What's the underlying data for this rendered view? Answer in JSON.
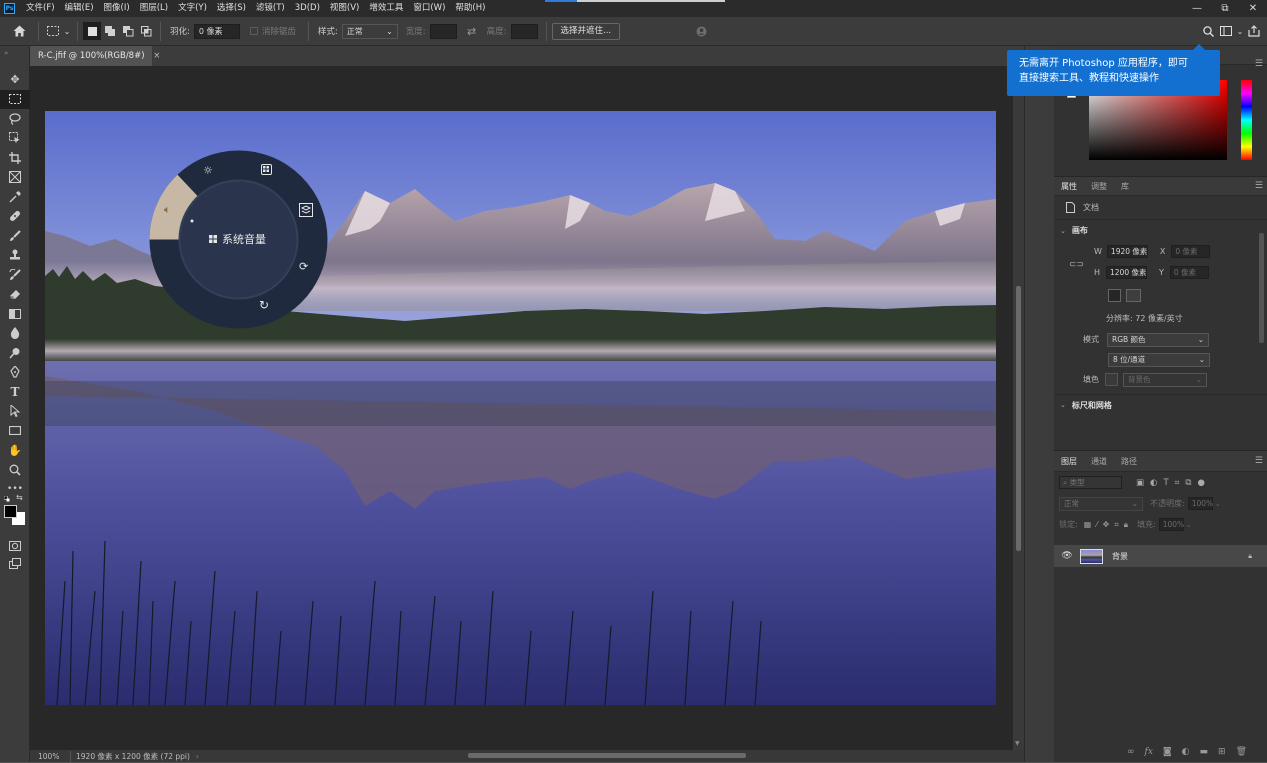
{
  "menu": [
    "文件(F)",
    "编辑(E)",
    "图像(I)",
    "图层(L)",
    "文字(Y)",
    "选择(S)",
    "滤镜(T)",
    "3D(D)",
    "视图(V)",
    "增效工具",
    "窗口(W)",
    "帮助(H)"
  ],
  "app_logo": "Ps",
  "window_controls": [
    "—",
    "⧉",
    "✕"
  ],
  "options": {
    "feather_label": "羽化:",
    "feather_value": "0 像素",
    "antialias_label": "消除锯齿",
    "style_label": "样式:",
    "style_value": "正常",
    "width_label": "宽度:",
    "height_label": "高度:",
    "select_mask_button": "选择并遮住..."
  },
  "document": {
    "tab_label": "R-C.jfif @ 100%(RGB/8#)",
    "tab_close": "×"
  },
  "status": {
    "zoom": "100%",
    "info": "1920 像素 x 1200 像素 (72 ppi)",
    "arrow": "›"
  },
  "radial_menu": {
    "center_label": "系统音量",
    "icons": [
      "brightness-icon",
      "grid-icon",
      "layers-icon",
      "rotate-icon",
      "refresh-icon",
      "volume-icon"
    ]
  },
  "tooltip": {
    "line1": "无需离开 Photoshop 应用程序，即可",
    "line2": "直接搜索工具、教程和快速操作"
  },
  "properties": {
    "tabs": [
      "属性",
      "调整",
      "库"
    ],
    "doc_label": "文档",
    "canvas_section": "画布",
    "w_label": "W",
    "w_value": "1920 像素",
    "h_label": "H",
    "h_value": "1200 像素",
    "x_label": "X",
    "x_value": "0 像素",
    "y_label": "Y",
    "y_value": "0 像素",
    "resolution": "分辨率: 72 像素/英寸",
    "mode_label": "模式",
    "mode_value": "RGB 颜色",
    "depth_value": "8 位/通道",
    "fill_label": "填色",
    "fill_value": "背景色",
    "rulers_section": "标尺和网格"
  },
  "layers": {
    "tabs": [
      "图层",
      "通道",
      "路径"
    ],
    "kind_placeholder": "类型",
    "blend_mode": "正常",
    "opacity_label": "不透明度:",
    "opacity_value": "100%",
    "lock_label": "锁定:",
    "fill_label": "填充:",
    "fill_value": "100%",
    "layer_name": "背景",
    "footer_icons": [
      "link-icon",
      "fx-icon",
      "mask-icon",
      "adjustment-icon",
      "folder-icon",
      "new-layer-icon",
      "trash-icon"
    ]
  },
  "colors": {
    "accent": "#1470d0",
    "radial_ring": "#1f2a3e",
    "radial_highlight": "#c7b8a5"
  }
}
